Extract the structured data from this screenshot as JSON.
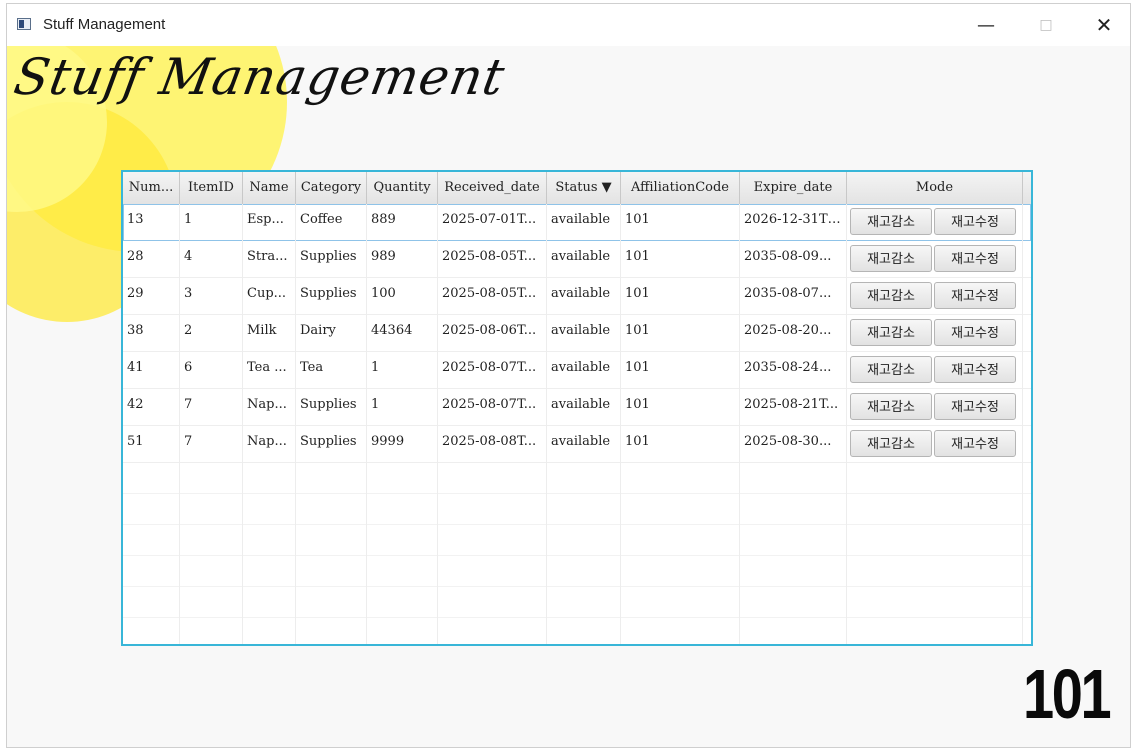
{
  "window": {
    "title": "Stuff Management",
    "controls": {
      "minimize": "—",
      "maximize": "□",
      "close": "✕"
    }
  },
  "app": {
    "heading": "Stuff Management",
    "affiliation_badge": "101"
  },
  "colors": {
    "accent_border": "#38b6d8",
    "decor_yellow": "#fff24a"
  },
  "table": {
    "columns": [
      "Num...",
      "ItemID",
      "Name",
      "Category",
      "Quantity",
      "Received_date",
      "Status ▼",
      "AffiliationCode",
      "Expire_date",
      "Mode"
    ],
    "rows": [
      {
        "num": "13",
        "item_id": "1",
        "name": "Esp...",
        "category": "Coffee",
        "quantity": "889",
        "received": "2025-07-01T...",
        "status": "available",
        "affiliation": "101",
        "expire": "2026-12-31T1...",
        "btn_decrease": "재고감소",
        "btn_edit": "재고수정"
      },
      {
        "num": "28",
        "item_id": "4",
        "name": "Stra...",
        "category": "Supplies",
        "quantity": "989",
        "received": "2025-08-05T...",
        "status": "available",
        "affiliation": "101",
        "expire": "2035-08-09...",
        "btn_decrease": "재고감소",
        "btn_edit": "재고수정"
      },
      {
        "num": "29",
        "item_id": "3",
        "name": "Cup...",
        "category": "Supplies",
        "quantity": "100",
        "received": "2025-08-05T...",
        "status": "available",
        "affiliation": "101",
        "expire": "2035-08-07...",
        "btn_decrease": "재고감소",
        "btn_edit": "재고수정"
      },
      {
        "num": "38",
        "item_id": "2",
        "name": "Milk",
        "category": "Dairy",
        "quantity": "44364",
        "received": "2025-08-06T...",
        "status": "available",
        "affiliation": "101",
        "expire": "2025-08-20...",
        "btn_decrease": "재고감소",
        "btn_edit": "재고수정"
      },
      {
        "num": "41",
        "item_id": "6",
        "name": "Tea ...",
        "category": "Tea",
        "quantity": "1",
        "received": "2025-08-07T...",
        "status": "available",
        "affiliation": "101",
        "expire": "2035-08-24...",
        "btn_decrease": "재고감소",
        "btn_edit": "재고수정"
      },
      {
        "num": "42",
        "item_id": "7",
        "name": "Nap...",
        "category": "Supplies",
        "quantity": "1",
        "received": "2025-08-07T...",
        "status": "available",
        "affiliation": "101",
        "expire": "2025-08-21T...",
        "btn_decrease": "재고감소",
        "btn_edit": "재고수정"
      },
      {
        "num": "51",
        "item_id": "7",
        "name": "Nap...",
        "category": "Supplies",
        "quantity": "9999",
        "received": "2025-08-08T...",
        "status": "available",
        "affiliation": "101",
        "expire": "2025-08-30...",
        "btn_decrease": "재고감소",
        "btn_edit": "재고수정"
      }
    ]
  }
}
